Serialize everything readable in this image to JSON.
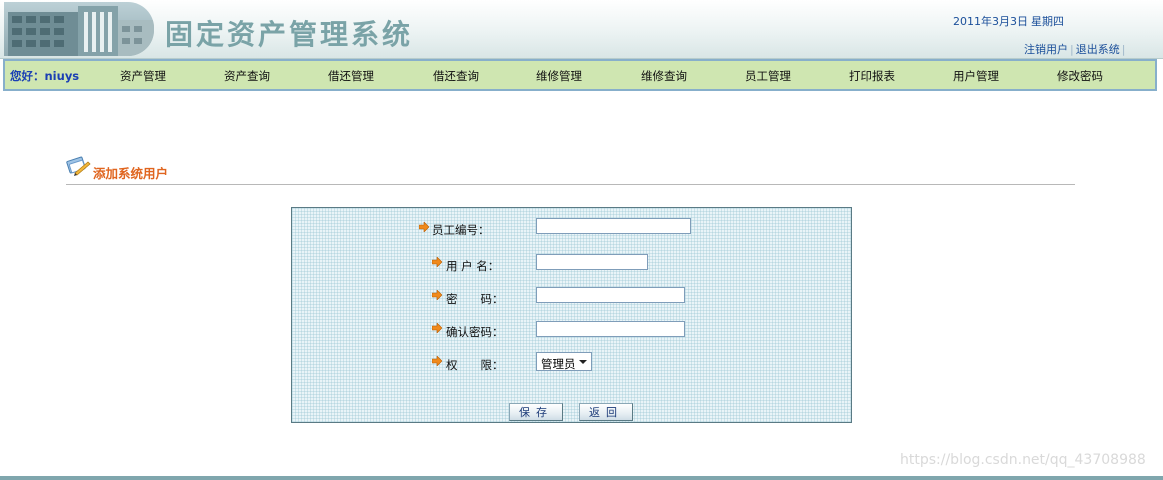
{
  "header": {
    "title": "固定资产管理系统",
    "date": "2011年3月3日",
    "weekday": "星期四",
    "links": [
      "注销用户",
      "退出系统"
    ]
  },
  "nav": {
    "greeting": "您好：niuys",
    "items": [
      "资产管理",
      "资产查询",
      "借还管理",
      "借还查询",
      "维修管理",
      "维修查询",
      "员工管理",
      "打印报表",
      "用户管理",
      "修改密码"
    ]
  },
  "page": {
    "section_title": "添加系统用户"
  },
  "form": {
    "employee_id_label": "员工编号：",
    "username_label": "用 户 名：",
    "password_label": "密　　码：",
    "confirm_label": "确认密码：",
    "permission_label": "权　　限：",
    "employee_id_value": "",
    "username_value": "",
    "password_value": "",
    "confirm_value": "",
    "permission_value": "管理员",
    "save_label": "保存",
    "back_label": "返回"
  },
  "watermark": "https://blog.csdn.net/qq_43708988",
  "colors": {
    "nav_bg": "#cfe6b1",
    "section_title": "#e0651f",
    "greeting": "#1a3fb4"
  }
}
